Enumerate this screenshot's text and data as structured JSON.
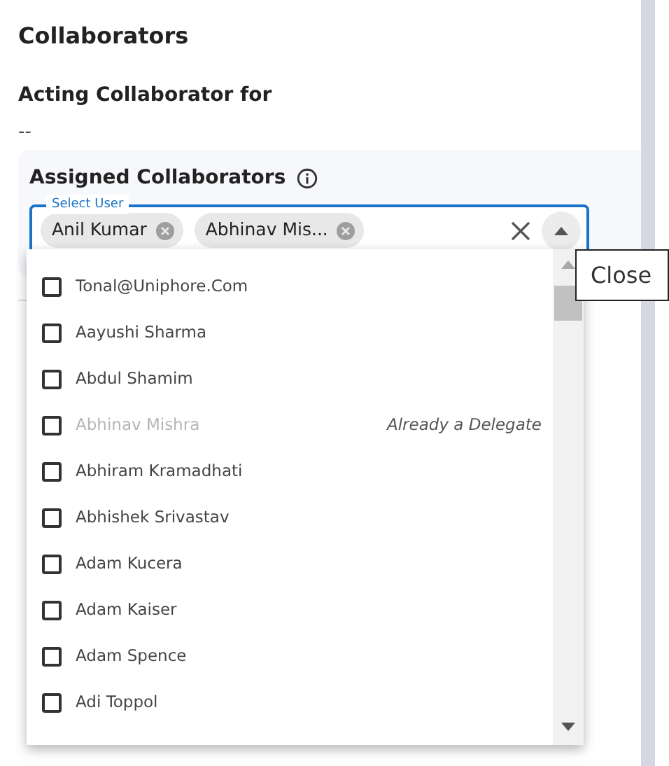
{
  "title": "Collaborators",
  "acting": {
    "label": "Acting Collaborator for",
    "value": "--"
  },
  "assigned": {
    "label": "Assigned Collaborators",
    "select": {
      "label": "Select User",
      "chips": [
        "Anil Kumar",
        "Abhinav Mis..."
      ]
    }
  },
  "dropdown": {
    "options": [
      {
        "name": "Tonal@Uniphore.Com",
        "checked": false,
        "disabled": false
      },
      {
        "name": "Aayushi Sharma",
        "checked": false,
        "disabled": false
      },
      {
        "name": "Abdul Shamim",
        "checked": false,
        "disabled": false
      },
      {
        "name": "Abhinav Mishra",
        "checked": false,
        "disabled": true,
        "note": "Already a Delegate"
      },
      {
        "name": "Abhiram Kramadhati",
        "checked": false,
        "disabled": false
      },
      {
        "name": "Abhishek Srivastav",
        "checked": false,
        "disabled": false
      },
      {
        "name": "Adam Kucera",
        "checked": false,
        "disabled": false
      },
      {
        "name": "Adam Kaiser",
        "checked": false,
        "disabled": false
      },
      {
        "name": "Adam Spence",
        "checked": false,
        "disabled": false
      },
      {
        "name": "Adi Toppol",
        "checked": false,
        "disabled": false
      }
    ]
  },
  "tooltip": "Close"
}
